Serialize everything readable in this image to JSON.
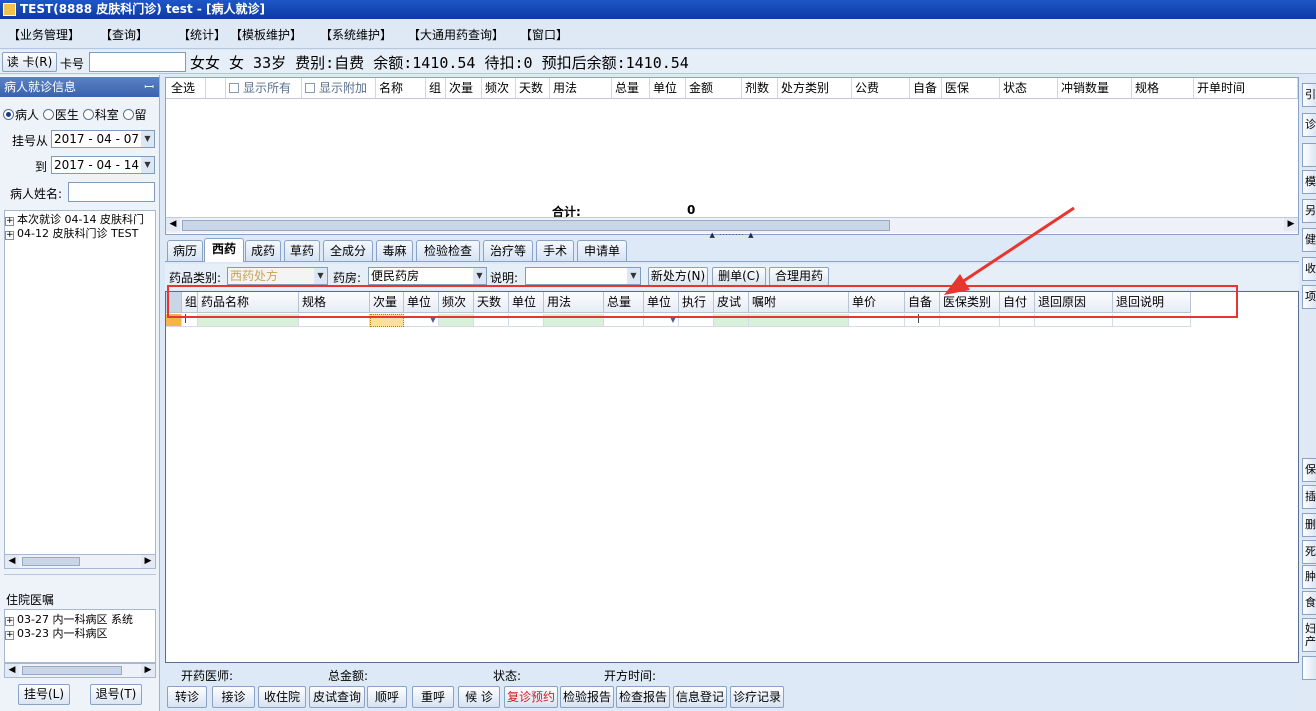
{
  "window": {
    "title": "TEST(8888 皮肤科门诊) test - [病人就诊]"
  },
  "menu": [
    "【业务管理】",
    "【查询】",
    "【统计】",
    "【模板维护】",
    "【系统维护】",
    "【大通用药查询】",
    "【窗口】"
  ],
  "patient_bar": {
    "read_card_label": "读 卡(R)",
    "card_label": "卡号",
    "card_value": "",
    "info": "女女 女 33岁 费别:自费 余额:1410.54 待扣:0 预扣后余额:1410.54"
  },
  "left": {
    "header": "病人就诊信息",
    "radios": [
      {
        "label": "病人",
        "checked": true
      },
      {
        "label": "医生",
        "checked": false
      },
      {
        "label": "科室",
        "checked": false
      },
      {
        "label": "留",
        "checked": false
      }
    ],
    "date_from_label": "挂号从",
    "date_from": "2017 - 04 - 07",
    "date_to_label": "到",
    "date_to": "2017 - 04 - 14",
    "name_label": "病人姓名:",
    "name_value": "",
    "visits": [
      "本次就诊 04-14 皮肤科门",
      "04-12 皮肤科门诊 TEST"
    ],
    "inpatient_header": "住院医嘱",
    "inpatient": [
      "03-27 内一科病区 系统",
      "03-23 内一科病区"
    ],
    "register_btn": "挂号(L)",
    "unregister_btn": "退号(T)"
  },
  "top_grid": {
    "columns": [
      "全选",
      "",
      "显示所有",
      "显示附加",
      "名称",
      "组",
      "次量",
      "频次",
      "天数",
      "用法",
      "总量",
      "单位",
      "金额",
      "剂数",
      "处方类别",
      "公费",
      "自备",
      "医保",
      "状态",
      "冲销数量",
      "规格",
      "开单时间"
    ],
    "total_label": "合计:",
    "total_value": "0"
  },
  "tabs": [
    {
      "label": "病历",
      "active": false
    },
    {
      "label": "西药",
      "active": true
    },
    {
      "label": "成药",
      "active": false
    },
    {
      "label": "草药",
      "active": false
    },
    {
      "label": "全成分",
      "active": false
    },
    {
      "label": "毒麻",
      "active": false
    },
    {
      "label": "检验检查",
      "active": false
    },
    {
      "label": "治疗等",
      "active": false
    },
    {
      "label": "手术",
      "active": false
    },
    {
      "label": "申请单",
      "active": false
    }
  ],
  "filter": {
    "category_label": "药品类别:",
    "category_value": "西药处方",
    "pharmacy_label": "药房:",
    "pharmacy_value": "便民药房",
    "note_label": "说明:",
    "note_value": "",
    "new_rx": "新处方(N)",
    "delete_rx": "删单(C)",
    "rational": "合理用药"
  },
  "rx_grid": {
    "columns": [
      "",
      "组",
      "药品名称",
      "规格",
      "次量",
      "单位",
      "频次",
      "天数",
      "单位",
      "用法",
      "总量",
      "单位",
      "执行",
      "皮试",
      "嘱咐",
      "单价",
      "自备",
      "医保类别",
      "自付",
      "退回原因",
      "退回说明"
    ]
  },
  "footer": {
    "doctor_label": "开药医师:",
    "total_label": "总金额:",
    "status_label": "状态:",
    "time_label": "开方时间:"
  },
  "bottom_buttons": [
    "转诊",
    "接诊",
    "收住院",
    "皮试查询",
    "顺呼",
    "重呼",
    "候 诊",
    "复诊预约",
    "检验报告",
    "检查报告",
    "信息登记",
    "诊疗记录"
  ],
  "right_strip_top": [
    "引",
    "诊",
    "",
    "模",
    "另",
    "健",
    "收",
    "项"
  ],
  "right_strip_bottom": [
    "保",
    "插",
    "删",
    "死",
    "肿",
    "食",
    "妇产"
  ],
  "colors": {
    "title": "#0c3aa5",
    "highlight_red": "#e8352e",
    "reserve_btn": "#d21e1e"
  }
}
